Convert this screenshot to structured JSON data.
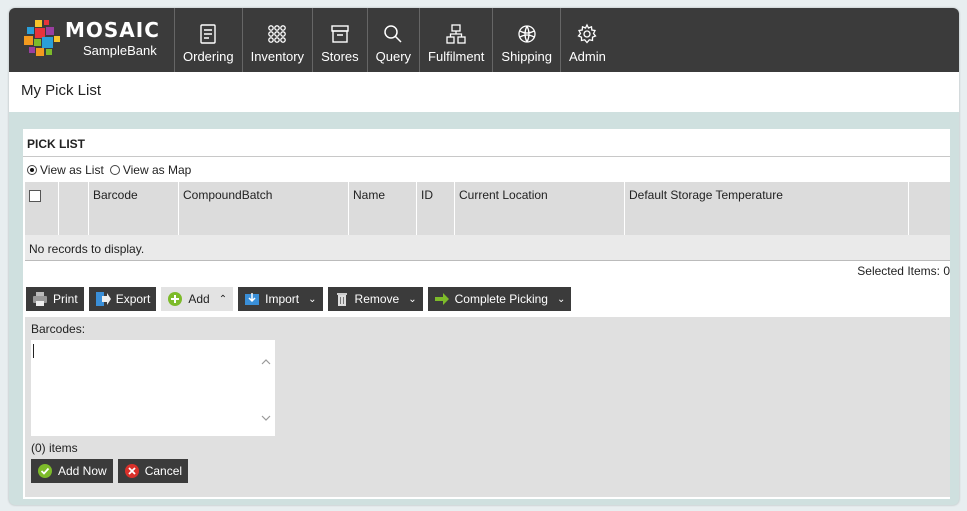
{
  "app": {
    "brand": "MOSAIC",
    "subtitle": "SampleBank"
  },
  "nav": [
    {
      "label": "Ordering",
      "icon": "list-icon"
    },
    {
      "label": "Inventory",
      "icon": "grid-icon"
    },
    {
      "label": "Stores",
      "icon": "archive-icon"
    },
    {
      "label": "Query",
      "icon": "search-icon"
    },
    {
      "label": "Fulfilment",
      "icon": "hierarchy-icon"
    },
    {
      "label": "Shipping",
      "icon": "globe-icon"
    },
    {
      "label": "Admin",
      "icon": "gear-icon"
    }
  ],
  "page": {
    "title": "My Pick List"
  },
  "panel": {
    "heading": "PICK LIST"
  },
  "view": {
    "list": "View as List",
    "map": "View as Map",
    "selected": "list"
  },
  "grid": {
    "columns": [
      "Barcode",
      "CompoundBatch",
      "Name",
      "ID",
      "Current Location",
      "Default Storage Temperature"
    ],
    "empty_text": "No records to display.",
    "selected_items": "Selected Items: 0"
  },
  "toolbar": {
    "print": "Print",
    "export": "Export",
    "add": "Add",
    "import": "Import",
    "remove": "Remove",
    "complete": "Complete Picking"
  },
  "add_panel": {
    "label": "Barcodes:",
    "value": "",
    "count": "(0) items",
    "add_now": "Add Now",
    "cancel": "Cancel"
  },
  "colors": {
    "header": "#3b3b3b",
    "accent_green": "#7dbb2a",
    "cancel_red": "#d9302a"
  }
}
